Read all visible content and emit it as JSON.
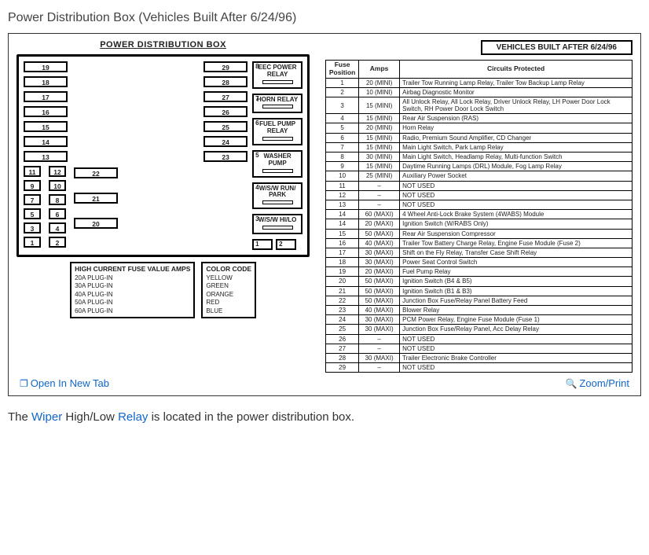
{
  "title": "Power Distribution Box (Vehicles Built After 6/24/96)",
  "left_header": "POWER DISTRIBUTION BOX",
  "right_header": "VEHICLES BUILT AFTER 6/24/96",
  "fuse_slots_left": [
    [
      "19",
      "29"
    ],
    [
      "18",
      "28"
    ],
    [
      "17",
      "27"
    ],
    [
      "16",
      "26"
    ],
    [
      "15",
      "25"
    ],
    [
      "14",
      "24"
    ],
    [
      "13",
      "23"
    ]
  ],
  "fuse_slots_mini_left": [
    [
      "11",
      "12"
    ],
    [
      "9",
      "10"
    ],
    [
      "7",
      "8"
    ],
    [
      "5",
      "6"
    ],
    [
      "3",
      "4"
    ],
    [
      "1",
      "2"
    ]
  ],
  "fuse_slots_mini_right": [
    "22",
    "21",
    "20"
  ],
  "relays": [
    {
      "num": "8",
      "label": "EEC POWER RELAY"
    },
    {
      "num": "7",
      "label": "HORN RELAY"
    },
    {
      "num": "6",
      "label": "FUEL PUMP RELAY"
    },
    {
      "num": "5",
      "label": "WASHER PUMP"
    },
    {
      "num": "4",
      "label": "W/S/W RUN/ PARK"
    },
    {
      "num": "3",
      "label": "W/S/W HI/LO"
    }
  ],
  "small_relays": [
    "1",
    "2"
  ],
  "legend_amps_header": "HIGH CURRENT FUSE VALUE AMPS",
  "legend_color_header": "COLOR CODE",
  "legend_amps": [
    "20A PLUG-IN",
    "30A PLUG-IN",
    "40A PLUG-IN",
    "50A PLUG-IN",
    "60A PLUG-IN"
  ],
  "legend_colors": [
    "YELLOW",
    "GREEN",
    "ORANGE",
    "RED",
    "BLUE"
  ],
  "table_headers": [
    "Fuse Position",
    "Amps",
    "Circuits Protected"
  ],
  "table_rows": [
    {
      "pos": "1",
      "amps": "20 (MINI)",
      "desc": "Trailer Tow Running Lamp Relay, Trailer Tow Backup Lamp Relay"
    },
    {
      "pos": "2",
      "amps": "10 (MINI)",
      "desc": "Airbag Diagnostic Monitor"
    },
    {
      "pos": "3",
      "amps": "15 (MINI)",
      "desc": "All Unlock Relay, All Lock Relay, Driver Unlock Relay, LH Power Door Lock Switch, RH Power Door Lock Switch"
    },
    {
      "pos": "4",
      "amps": "15 (MINI)",
      "desc": "Rear Air Suspension (RAS)"
    },
    {
      "pos": "5",
      "amps": "20 (MINI)",
      "desc": "Horn Relay"
    },
    {
      "pos": "6",
      "amps": "15 (MINI)",
      "desc": "Radio, Premium Sound Amplifier, CD Changer"
    },
    {
      "pos": "7",
      "amps": "15 (MINI)",
      "desc": "Main Light Switch, Park Lamp Relay"
    },
    {
      "pos": "8",
      "amps": "30 (MINI)",
      "desc": "Main Light Switch, Headlamp Relay, Multi-function Switch"
    },
    {
      "pos": "9",
      "amps": "15 (MINI)",
      "desc": "Daytime Running Lamps (DRL) Module, Fog Lamp Relay"
    },
    {
      "pos": "10",
      "amps": "25 (MINI)",
      "desc": "Auxiliary Power Socket"
    },
    {
      "pos": "11",
      "amps": "–",
      "desc": "NOT USED"
    },
    {
      "pos": "12",
      "amps": "–",
      "desc": "NOT USED"
    },
    {
      "pos": "13",
      "amps": "–",
      "desc": "NOT USED"
    },
    {
      "pos": "14",
      "amps": "60 (MAXI)",
      "desc": "4 Wheel Anti-Lock Brake System (4WABS) Module"
    },
    {
      "pos": "14",
      "amps": "20 (MAXI)",
      "desc": "Ignition Switch (W/RABS Only)"
    },
    {
      "pos": "15",
      "amps": "50 (MAXI)",
      "desc": "Rear Air Suspension Compressor"
    },
    {
      "pos": "16",
      "amps": "40 (MAXI)",
      "desc": "Trailer Tow Battery Charge Relay, Engine Fuse Module (Fuse 2)"
    },
    {
      "pos": "17",
      "amps": "30 (MAXI)",
      "desc": "Shift on the Fly Relay, Transfer Case Shift Relay"
    },
    {
      "pos": "18",
      "amps": "30 (MAXI)",
      "desc": "Power Seat Control Switch"
    },
    {
      "pos": "19",
      "amps": "20 (MAXI)",
      "desc": "Fuel Pump Relay"
    },
    {
      "pos": "20",
      "amps": "50 (MAXI)",
      "desc": "Ignition Switch (B4 & B5)"
    },
    {
      "pos": "21",
      "amps": "50 (MAXI)",
      "desc": "Ignition Switch (B1 & B3)"
    },
    {
      "pos": "22",
      "amps": "50 (MAXI)",
      "desc": "Junction Box Fuse/Relay Panel Battery Feed"
    },
    {
      "pos": "23",
      "amps": "40 (MAXI)",
      "desc": "Blower Relay"
    },
    {
      "pos": "24",
      "amps": "30 (MAXI)",
      "desc": "PCM Power Relay, Engine Fuse Module (Fuse 1)"
    },
    {
      "pos": "25",
      "amps": "30 (MAXI)",
      "desc": "Junction Box Fuse/Relay Panel, Acc Delay Relay"
    },
    {
      "pos": "26",
      "amps": "–",
      "desc": "NOT USED"
    },
    {
      "pos": "27",
      "amps": "–",
      "desc": "NOT USED"
    },
    {
      "pos": "28",
      "amps": "30 (MAXI)",
      "desc": "Trailer Electronic Brake Controller"
    },
    {
      "pos": "29",
      "amps": "–",
      "desc": "NOT USED"
    }
  ],
  "toolbar": {
    "open_label": "Open In New Tab",
    "zoom_label": "Zoom/Print"
  },
  "caption_parts": {
    "prefix": "The ",
    "link1": "Wiper",
    "mid": " High/Low ",
    "link2": "Relay",
    "suffix": " is located in the power distribution box."
  }
}
